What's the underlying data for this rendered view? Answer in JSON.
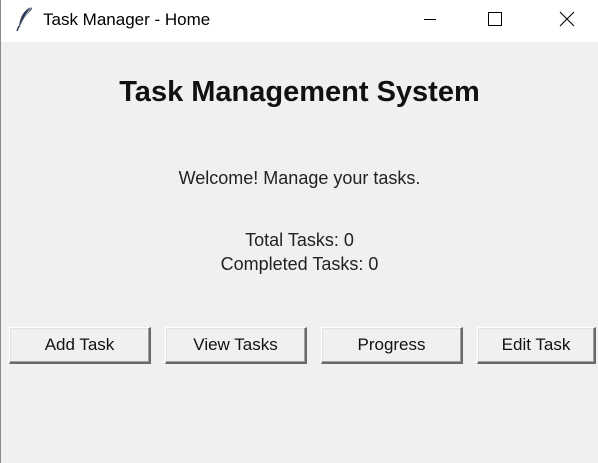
{
  "window": {
    "title": "Task Manager - Home",
    "icon": "feather-icon",
    "controls": [
      "minimize-icon",
      "maximize-icon",
      "close-icon"
    ]
  },
  "main": {
    "heading": "Task Management System",
    "welcome": "Welcome! Manage your tasks.",
    "total_tasks": "Total Tasks: 0",
    "completed_tasks": "Completed Tasks: 0"
  },
  "buttons": {
    "add_task": "Add Task",
    "view_tasks": "View Tasks",
    "progress": "Progress",
    "edit_task": "Edit Task"
  }
}
